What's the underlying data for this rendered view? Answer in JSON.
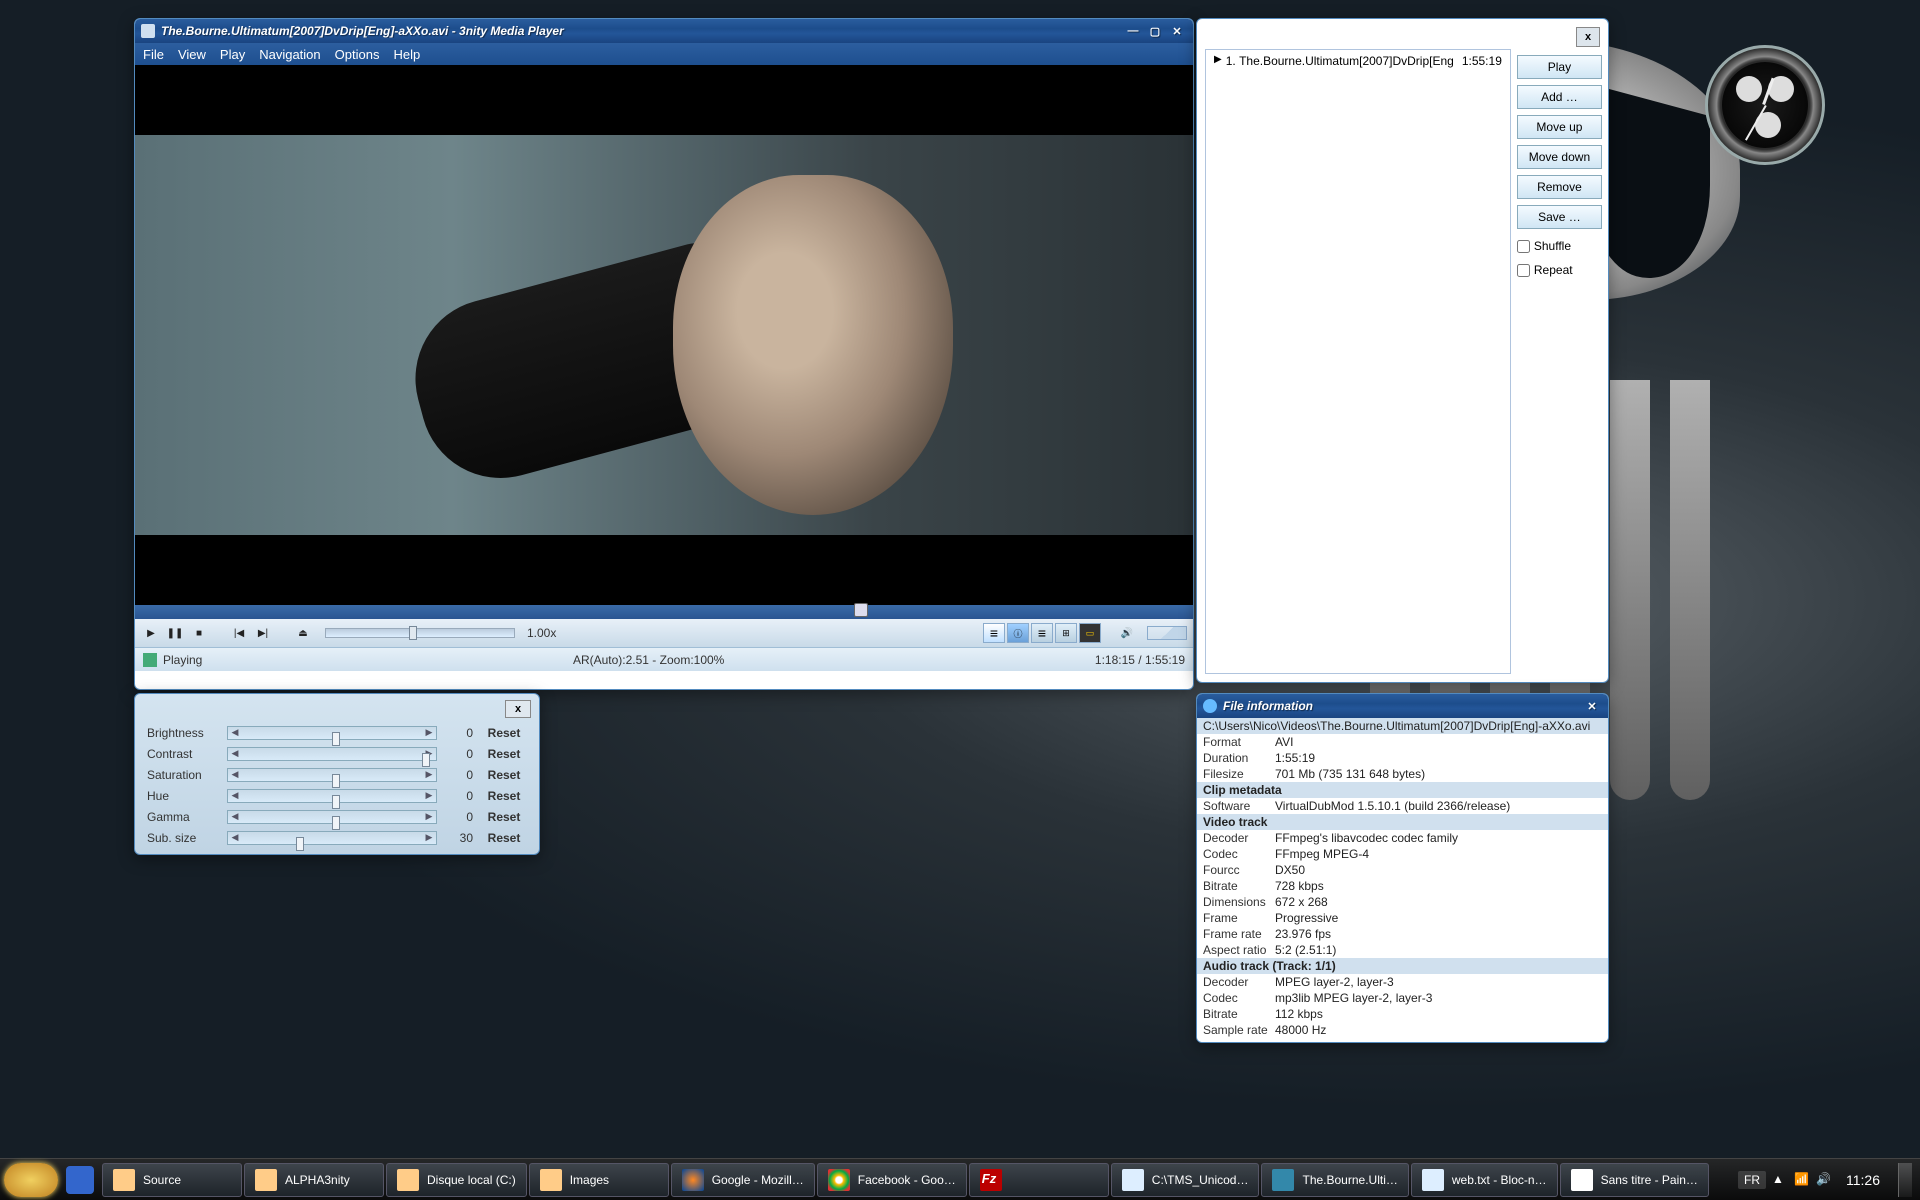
{
  "player": {
    "title": "The.Bourne.Ultimatum[2007]DvDrip[Eng]-aXXo.avi - 3nity Media Player",
    "menu": [
      "File",
      "View",
      "Play",
      "Navigation",
      "Options",
      "Help"
    ],
    "rate": "1.00x",
    "status": {
      "state": "Playing",
      "ar_zoom": "AR(Auto):2.51 - Zoom:100%",
      "time": "1:18:15 / 1:55:19"
    }
  },
  "playlist": {
    "close": "x",
    "item": {
      "index": "1.",
      "name": "The.Bourne.Ultimatum[2007]DvDrip[Eng",
      "duration": "1:55:19"
    },
    "buttons": [
      "Play",
      "Add …",
      "Move up",
      "Move down",
      "Remove",
      "Save …"
    ],
    "checks": [
      "Shuffle",
      "Repeat"
    ]
  },
  "adjust": {
    "close": "x",
    "rows": [
      {
        "label": "Brightness",
        "value": "0",
        "thumb": 50
      },
      {
        "label": "Contrast",
        "value": "0",
        "thumb": 100
      },
      {
        "label": "Saturation",
        "value": "0",
        "thumb": 50
      },
      {
        "label": "Hue",
        "value": "0",
        "thumb": 50
      },
      {
        "label": "Gamma",
        "value": "0",
        "thumb": 50
      },
      {
        "label": "Sub. size",
        "value": "30",
        "thumb": 30
      }
    ],
    "reset": "Reset"
  },
  "fileinfo": {
    "title": "File information",
    "path": "C:\\Users\\Nico\\Videos\\The.Bourne.Ultimatum[2007]DvDrip[Eng]-aXXo.avi",
    "rows": [
      {
        "k": "Format",
        "v": "AVI"
      },
      {
        "k": "Duration",
        "v": "1:55:19"
      },
      {
        "k": "Filesize",
        "v": "701 Mb (735 131 648 bytes)"
      }
    ],
    "clip_hdr": "Clip metadata",
    "clip": [
      {
        "k": "Software",
        "v": "VirtualDubMod 1.5.10.1 (build 2366/release)"
      }
    ],
    "video_hdr": "Video track",
    "video": [
      {
        "k": "Decoder",
        "v": "FFmpeg's libavcodec codec family"
      },
      {
        "k": "Codec",
        "v": "FFmpeg MPEG-4"
      },
      {
        "k": "Fourcc",
        "v": "DX50"
      },
      {
        "k": "Bitrate",
        "v": "728 kbps"
      },
      {
        "k": "Dimensions",
        "v": "672 x 268"
      },
      {
        "k": "Frame",
        "v": "Progressive"
      },
      {
        "k": "Frame rate",
        "v": "23.976 fps"
      },
      {
        "k": "Aspect ratio",
        "v": "5:2  (2.51:1)"
      }
    ],
    "audio_hdr": "Audio track     (Track: 1/1)",
    "audio": [
      {
        "k": "Decoder",
        "v": "MPEG layer-2, layer-3"
      },
      {
        "k": "Codec",
        "v": "mp3lib MPEG layer-2, layer-3"
      },
      {
        "k": "Bitrate",
        "v": "112 kbps"
      },
      {
        "k": "Sample rate",
        "v": "48000 Hz"
      }
    ]
  },
  "taskbar": {
    "items": [
      {
        "label": "Source",
        "ico": "fold"
      },
      {
        "label": "ALPHA3nity",
        "ico": "fold"
      },
      {
        "label": "Disque local (C:)",
        "ico": "fold"
      },
      {
        "label": "Images",
        "ico": "fold"
      },
      {
        "label": "Google - Mozill…",
        "ico": "fx"
      },
      {
        "label": "Facebook - Goo…",
        "ico": "ch"
      },
      {
        "label": "",
        "ico": "fz"
      },
      {
        "label": "C:\\TMS_Unicod…",
        "ico": "np"
      },
      {
        "label": "The.Bourne.Ulti…",
        "ico": "pl"
      },
      {
        "label": "web.txt - Bloc-n…",
        "ico": "np"
      },
      {
        "label": "Sans titre - Pain…",
        "ico": "pn"
      }
    ],
    "lang": "FR",
    "time": "11:26"
  }
}
